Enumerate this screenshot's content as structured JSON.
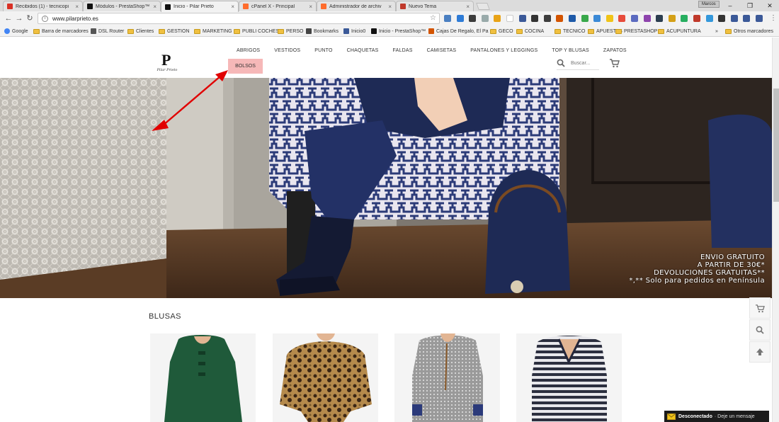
{
  "browser": {
    "tabs": [
      {
        "title": "Recibidos (1) - tecnicopi",
        "close": "×"
      },
      {
        "title": "Módulos - PrestaShop™",
        "close": "×"
      },
      {
        "title": "Inicio - Pilar Prieto",
        "close": "×",
        "active": true
      },
      {
        "title": "cPanel X - Principal",
        "close": "×"
      },
      {
        "title": "Administrador de archiv",
        "close": "×"
      },
      {
        "title": "Nuevo Tema",
        "close": "×"
      }
    ],
    "user_badge": "Marcos",
    "url": "www.pilarprieto.es",
    "window_controls": {
      "minimize": "–",
      "maximize": "❐",
      "close": "✕"
    },
    "bookmarks": [
      "Google",
      "Barra de marcadores",
      "DSL Router",
      "Clientes",
      "GESTION",
      "MARKETING",
      "PUBLI COCHES",
      "PERSO",
      "Bookmarks",
      "Inicio0",
      "Inicio - PrestaShop™",
      "Cajas De Regalo, El Pa",
      "GECO",
      "COCINA",
      "TECNICO",
      "APUESTAS",
      "PRESTASHOP",
      "ACUPUNTURA"
    ],
    "bookmarks_overflow": "»",
    "other_bookmarks": "Otros marcadores",
    "extension_colors": [
      "#4a7fc1",
      "#2e7bd6",
      "#3c3c3c",
      "#9aa",
      "#e8a317",
      "#fff",
      "#3b5998",
      "#333",
      "#3d3d3d",
      "#d35400",
      "#1e5aa8",
      "#39a84b",
      "#3c8ad6",
      "#f0c419",
      "#e74c3c",
      "#5c6bc0",
      "#8e44ad",
      "#2c3e50",
      "#d4a017",
      "#27ae60",
      "#c0392b",
      "#3498db",
      "#333",
      "#3b5998",
      "#3b5998",
      "#3b5998"
    ]
  },
  "site": {
    "logo_letter": "P",
    "logo_text": "Pilar Prieto",
    "nav": [
      "ABRIGOS",
      "VESTIDOS",
      "PUNTO",
      "CHAQUETAS",
      "FALDAS",
      "CAMISETAS",
      "PANTALONES Y LEGGINGS",
      "TOP Y BLUSAS",
      "ZAPATOS"
    ],
    "nav_highlight": "BOLSOS",
    "search_placeholder": "Buscar...",
    "hero_lines": [
      "ENVIO GRATUITO",
      "A PARTIR DE 30€*",
      "DEVOLUCIONES GRATUITAS**",
      "*,** Solo para pedidos en Península"
    ],
    "section_title": "BLUSAS",
    "chat_status": "Desconectado",
    "chat_message": "· Deje un mensaje"
  }
}
